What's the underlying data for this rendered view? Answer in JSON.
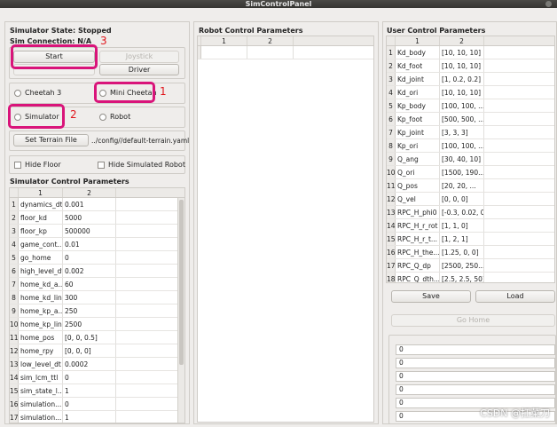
{
  "window": {
    "title": "SimControlPanel"
  },
  "status": {
    "state": "Simulator State: Stopped",
    "connection": "Sim Connection: N/A"
  },
  "controls": {
    "start": "Start",
    "joystick": "Joystick",
    "hidden_button": "...",
    "driver": "Driver",
    "robot_type": [
      "Cheetah 3",
      "Mini Cheetah"
    ],
    "mode": [
      "Simulator",
      "Robot"
    ],
    "set_terrain": "Set Terrain File",
    "terrain_path": "../config//default-terrain.yaml",
    "hide_floor": "Hide Floor",
    "hide_simulated_robot": "Hide Simulated Robot"
  },
  "annotations": {
    "n1": "1",
    "n2": "2",
    "n3": "3"
  },
  "simulator_params": {
    "title": "Simulator Control Parameters",
    "headers": [
      "1",
      "2"
    ],
    "rows": [
      [
        "dynamics_dt",
        "0.001"
      ],
      [
        "floor_kd",
        "5000"
      ],
      [
        "floor_kp",
        "500000"
      ],
      [
        "game_cont...",
        "0.01"
      ],
      [
        "go_home",
        "0"
      ],
      [
        "high_level_dt",
        "0.002"
      ],
      [
        "home_kd_a...",
        "60"
      ],
      [
        "home_kd_lin",
        "300"
      ],
      [
        "home_kp_a...",
        "250"
      ],
      [
        "home_kp_lin",
        "2500"
      ],
      [
        "home_pos",
        "[0, 0, 0.5]"
      ],
      [
        "home_rpy",
        "[0, 0, 0]"
      ],
      [
        "low_level_dt",
        "0.0002"
      ],
      [
        "sim_lcm_ttl",
        "0"
      ],
      [
        "sim_state_l...",
        "1"
      ],
      [
        "simulation...",
        "0"
      ],
      [
        "simulation...",
        "1"
      ]
    ]
  },
  "robot_params": {
    "title": "Robot Control Parameters",
    "headers": [
      "1",
      "2"
    ]
  },
  "user_params": {
    "title": "User Control Parameters",
    "headers": [
      "1",
      "2"
    ],
    "rows": [
      [
        "Kd_body",
        "[10, 10, 10]"
      ],
      [
        "Kd_foot",
        "[10, 10, 10]"
      ],
      [
        "Kd_joint",
        "[1, 0.2, 0.2]"
      ],
      [
        "Kd_ori",
        "[10, 10, 10]"
      ],
      [
        "Kp_body",
        "[100, 100, ..."
      ],
      [
        "Kp_foot",
        "[500, 500, ..."
      ],
      [
        "Kp_joint",
        "[3, 3, 3]"
      ],
      [
        "Kp_ori",
        "[100, 100, ..."
      ],
      [
        "Q_ang",
        "[30, 40, 10]"
      ],
      [
        "Q_ori",
        "[1500, 190..."
      ],
      [
        "Q_pos",
        "[20, 20, ..."
      ],
      [
        "Q_vel",
        "[0, 0, 0]"
      ],
      [
        "RPC_H_phi0",
        "[-0.3, 0.02, 0]"
      ],
      [
        "RPC_H_r_rot",
        "[1, 1, 0]"
      ],
      [
        "RPC_H_r_t...",
        "[1, 2, 1]"
      ],
      [
        "RPC_H_the...",
        "[1.25, 0, 0]"
      ],
      [
        "RPC_Q_dp",
        "[2500, 250..."
      ],
      [
        "RPC_Q_dth...",
        "[2.5, 2.5, 50]"
      ]
    ],
    "save": "Save",
    "load": "Load",
    "go_home": "Go Home",
    "fields": [
      "0",
      "0",
      "0",
      "0",
      "0",
      "0"
    ]
  },
  "watermark": "CSDN @扛菜刀",
  "colors": {
    "highlight": "#d9147a",
    "annotation": "#e0161c"
  }
}
